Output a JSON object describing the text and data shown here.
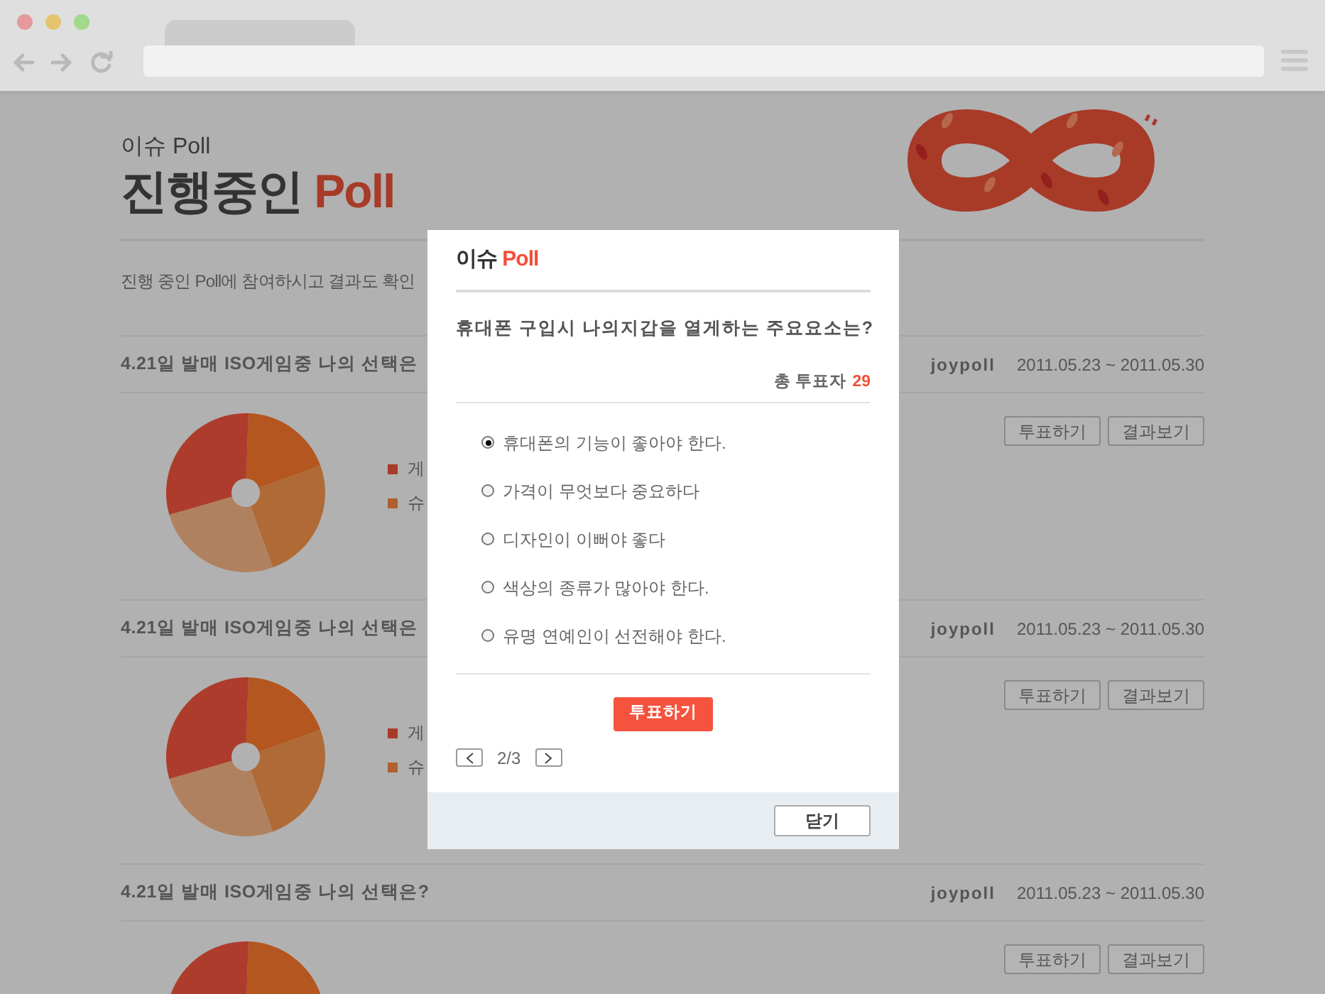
{
  "page": {
    "kicker": "이슈 Poll",
    "title": {
      "text": "진행중인",
      "accent": "Poll"
    },
    "description": "진행 중인 Poll에 참여하시고 결과도 확인"
  },
  "polls": [
    {
      "title": "4.21일 발매 ISO게임중 나의 선택은",
      "author": "joypoll",
      "date": "2011.05.23 ~ 2011.05.30",
      "buttons": [
        "투표하기",
        "결과보기"
      ],
      "legend": [
        {
          "label": "게",
          "color": "#a83a28"
        },
        {
          "label": "슈",
          "color": "#b0602e"
        }
      ]
    },
    {
      "title": "4.21일 발매 ISO게임중 나의 선택은",
      "author": "joypoll",
      "date": "2011.05.23 ~ 2011.05.30",
      "buttons": [
        "투표하기",
        "결과보기"
      ],
      "legend": [
        {
          "label": "게",
          "color": "#a83a28"
        },
        {
          "label": "슈",
          "color": "#b0602e"
        }
      ]
    },
    {
      "title": "4.21일 발매 ISO게임중 나의 선택은?",
      "author": "joypoll",
      "date": "2011.05.23 ~ 2011.05.30",
      "buttons": [
        "투표하기",
        "결과보기"
      ]
    }
  ],
  "modal": {
    "title": {
      "text": "이슈",
      "accent": "Poll"
    },
    "question": "휴대폰 구입시 나의지갑을 열게하는 주요요소는?",
    "total_label": "총 투표자",
    "total_count": "29",
    "options": [
      {
        "label": "휴대폰의 기능이 좋아야 한다.",
        "selected": true
      },
      {
        "label": "가격이 무엇보다 중요하다",
        "selected": false
      },
      {
        "label": "디자인이 이뻐야 좋다",
        "selected": false
      },
      {
        "label": "색상의 종류가 많아야 한다.",
        "selected": false
      },
      {
        "label": "유명 연예인이 선전해야 한다.",
        "selected": false
      }
    ],
    "vote_button": "투표하기",
    "pager": "2/3",
    "close_button": "닫기"
  }
}
